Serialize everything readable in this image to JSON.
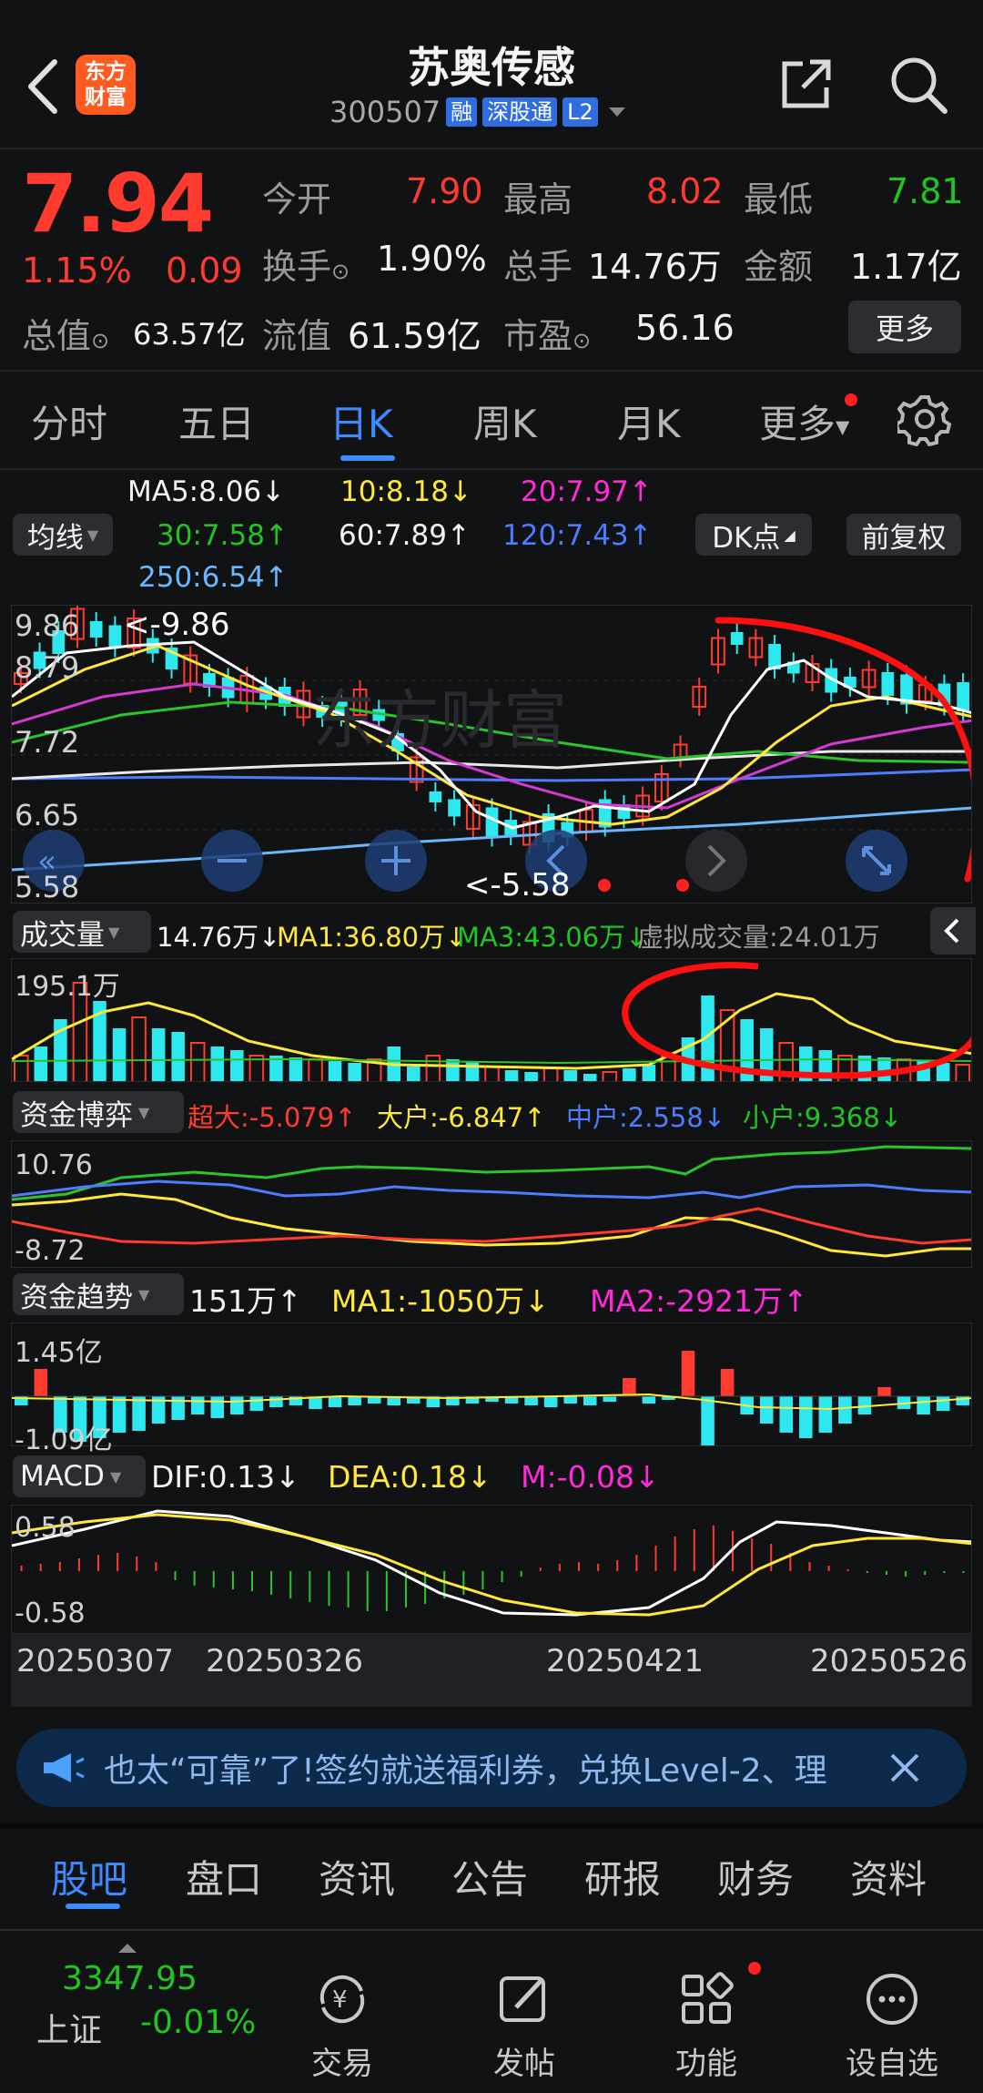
{
  "header": {
    "back_icon": "chevron-left-icon",
    "logo_text": "东方\n财富",
    "title": "苏奥传感",
    "code": "300507",
    "tags": [
      "融",
      "深股通",
      "L2"
    ],
    "share_icon": "share-icon",
    "search_icon": "search-icon"
  },
  "quote": {
    "price": "7.94",
    "change_pct": "1.15%",
    "change": "0.09",
    "stats": [
      {
        "label": "今开",
        "value": "7.90",
        "color": "red"
      },
      {
        "label": "最高",
        "value": "8.02",
        "color": "red"
      },
      {
        "label": "最低",
        "value": "7.81",
        "color": "green"
      },
      {
        "label": "换手",
        "value": "1.90%",
        "color": "white"
      },
      {
        "label": "总手",
        "value": "14.76万",
        "color": "white"
      },
      {
        "label": "金额",
        "value": "1.17亿",
        "color": "white"
      },
      {
        "label": "总值",
        "value": "63.57亿",
        "color": "white"
      },
      {
        "label": "流值",
        "value": "61.59亿",
        "color": "white"
      },
      {
        "label": "市盈",
        "value": "56.16",
        "color": "white"
      }
    ],
    "more_label": "更多"
  },
  "tabs": [
    "分时",
    "五日",
    "日K",
    "周K",
    "月K",
    "更多"
  ],
  "active_tab": "日K",
  "ma": {
    "selector": "均线",
    "ma5": "MA5:8.06↓",
    "ma10": "10:8.18↓",
    "ma20": "20:7.97↑",
    "ma30": "30:7.58↑",
    "ma60": "60:7.89↑",
    "ma120": "120:7.43↑",
    "ma250": "250:6.54↑",
    "dk_label": "DK点",
    "adjust_label": "前复权"
  },
  "kline": {
    "axis": [
      "9.86",
      "8.79",
      "7.72",
      "6.65",
      "5.58"
    ],
    "high_mark": "<-9.86",
    "low_mark": "<-5.58"
  },
  "volume": {
    "selector": "成交量",
    "v": "14.76万↓",
    "ma1": "MA1:36.80万↓",
    "ma3": "MA3:43.06万↓",
    "virtual": "虚拟成交量:24.01万",
    "axis_top": "195.1万"
  },
  "fund_game": {
    "selector": "资金博弈",
    "super": "超大:-5.079↑",
    "large": "大户:-6.847↑",
    "mid": "中户:2.558↓",
    "small": "小户:9.368↓",
    "axis_top": "10.76",
    "axis_bottom": "-8.72"
  },
  "fund_trend": {
    "selector": "资金趋势",
    "v": "151万↑",
    "ma1": "MA1:-1050万↓",
    "ma2": "MA2:-2921万↑",
    "axis_top": "1.45亿",
    "axis_bottom": "-1.09亿"
  },
  "macd": {
    "selector": "MACD",
    "dif": "DIF:0.13↓",
    "dea": "DEA:0.18↓",
    "m": "M:-0.08↓",
    "axis_top": "0.58",
    "axis_bottom": "-0.58"
  },
  "dates": [
    "20250307",
    "20250326",
    "20250421",
    "20250526"
  ],
  "banner": {
    "text": "也太“可靠”了!签约就送福利券，兑换Level-2、理"
  },
  "bottom_tabs": [
    "股吧",
    "盘口",
    "资讯",
    "公告",
    "研报",
    "财务",
    "资料"
  ],
  "nav": {
    "index_value": "3347.95",
    "index_name": "上证",
    "index_change": "-0.01%",
    "items": [
      "交易",
      "发帖",
      "功能",
      "设自选"
    ]
  },
  "colors": {
    "up": "#ff3b30",
    "down": "#2ee8f0",
    "accent": "#3d8bff"
  }
}
